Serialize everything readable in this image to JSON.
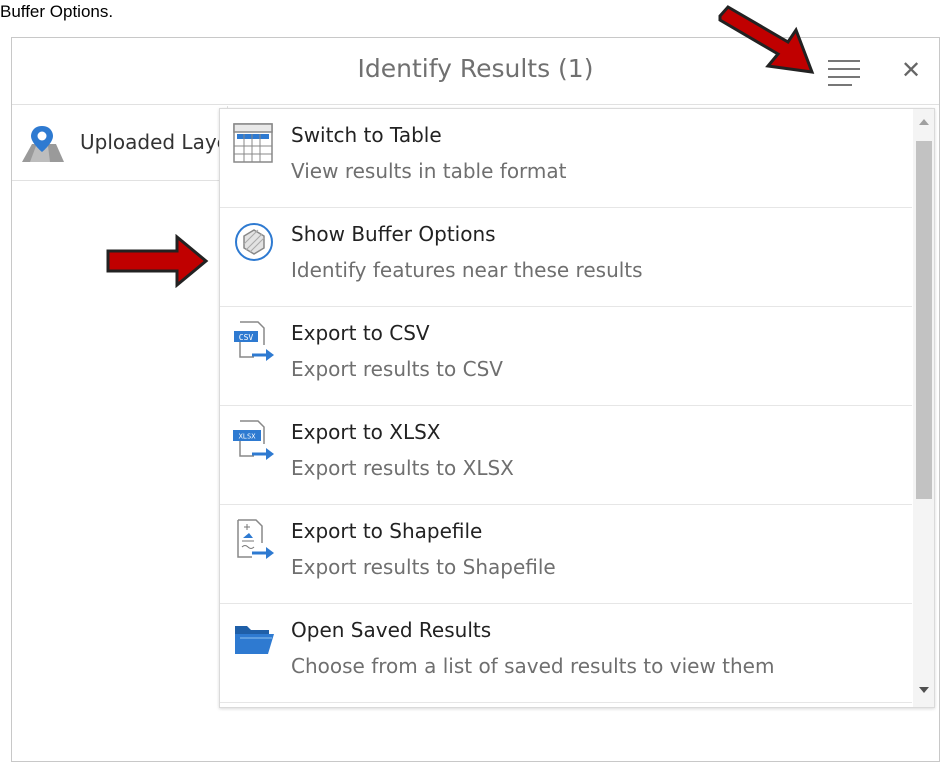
{
  "caption": "Buffer Options.",
  "window": {
    "title": "Identify Results (1)",
    "close_label": "✕"
  },
  "layer_tab": {
    "label": "Uploaded Layers",
    "icon": "map-pin-icon"
  },
  "menu": {
    "items": [
      {
        "label": "Switch to Table",
        "description": "View results in table format",
        "icon": "table-icon"
      },
      {
        "label": "Show Buffer Options",
        "description": "Identify features near these results",
        "icon": "buffer-icon"
      },
      {
        "label": "Export to CSV",
        "description": "Export results to CSV",
        "icon": "csv-export-icon"
      },
      {
        "label": "Export to XLSX",
        "description": "Export results to XLSX",
        "icon": "xlsx-export-icon"
      },
      {
        "label": "Export to Shapefile",
        "description": "Export results to Shapefile",
        "icon": "shapefile-export-icon"
      },
      {
        "label": "Open Saved Results",
        "description": "Choose from a list of saved results to view them",
        "icon": "folder-open-icon"
      }
    ]
  },
  "icon_text": {
    "csv": "CSV",
    "xlsx": "XLSX"
  },
  "colors": {
    "accent_blue": "#2e7ad1",
    "annotation_red": "#c00000"
  }
}
